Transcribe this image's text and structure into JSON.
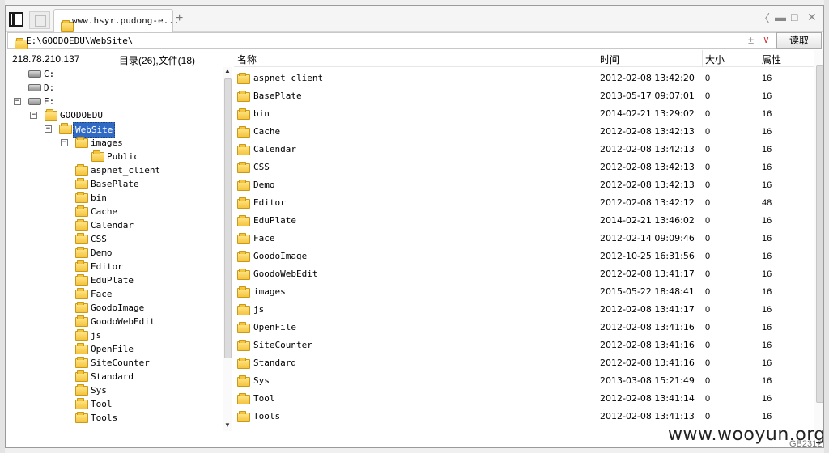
{
  "tabbar": {
    "tab_label": "www.hsyr.pudong-e...",
    "close_glyph": "×",
    "add_glyph": "+",
    "ctrl_back": "〈",
    "ctrl_min": "▬",
    "ctrl_max": "□",
    "ctrl_close": "✕"
  },
  "address": {
    "path": "E:\\GOODOEDU\\WebSite\\",
    "plus_glyph": "±",
    "chevron_glyph": "∨",
    "read_button": "读取"
  },
  "info": {
    "ip": "218.78.210.137",
    "counts": "目录(26),文件(18)"
  },
  "columns": {
    "name": "名称",
    "time": "时间",
    "size": "大小",
    "attr": "属性"
  },
  "tree": {
    "drives": [
      "C:",
      "D:",
      "E:"
    ],
    "goodoedu": "GOODOEDU",
    "website": "WebSite",
    "images": "images",
    "public": "Public",
    "folders": [
      "aspnet_client",
      "BasePlate",
      "bin",
      "Cache",
      "Calendar",
      "CSS",
      "Demo",
      "Editor",
      "EduPlate",
      "Face",
      "GoodoImage",
      "GoodoWebEdit",
      "js",
      "OpenFile",
      "SiteCounter",
      "Standard",
      "Sys",
      "Tool",
      "Tools"
    ],
    "toggle_minus": "−"
  },
  "files": [
    {
      "name": "aspnet_client",
      "time": "2012-02-08 13:42:20",
      "size": "0",
      "attr": "16"
    },
    {
      "name": "BasePlate",
      "time": "2013-05-17 09:07:01",
      "size": "0",
      "attr": "16"
    },
    {
      "name": "bin",
      "time": "2014-02-21 13:29:02",
      "size": "0",
      "attr": "16"
    },
    {
      "name": "Cache",
      "time": "2012-02-08 13:42:13",
      "size": "0",
      "attr": "16"
    },
    {
      "name": "Calendar",
      "time": "2012-02-08 13:42:13",
      "size": "0",
      "attr": "16"
    },
    {
      "name": "CSS",
      "time": "2012-02-08 13:42:13",
      "size": "0",
      "attr": "16"
    },
    {
      "name": "Demo",
      "time": "2012-02-08 13:42:13",
      "size": "0",
      "attr": "16"
    },
    {
      "name": "Editor",
      "time": "2012-02-08 13:42:12",
      "size": "0",
      "attr": "48"
    },
    {
      "name": "EduPlate",
      "time": "2014-02-21 13:46:02",
      "size": "0",
      "attr": "16"
    },
    {
      "name": "Face",
      "time": "2012-02-14 09:09:46",
      "size": "0",
      "attr": "16"
    },
    {
      "name": "GoodoImage",
      "time": "2012-10-25 16:31:56",
      "size": "0",
      "attr": "16"
    },
    {
      "name": "GoodoWebEdit",
      "time": "2012-02-08 13:41:17",
      "size": "0",
      "attr": "16"
    },
    {
      "name": "images",
      "time": "2015-05-22 18:48:41",
      "size": "0",
      "attr": "16"
    },
    {
      "name": "js",
      "time": "2012-02-08 13:41:17",
      "size": "0",
      "attr": "16"
    },
    {
      "name": "OpenFile",
      "time": "2012-02-08 13:41:16",
      "size": "0",
      "attr": "16"
    },
    {
      "name": "SiteCounter",
      "time": "2012-02-08 13:41:16",
      "size": "0",
      "attr": "16"
    },
    {
      "name": "Standard",
      "time": "2012-02-08 13:41:16",
      "size": "0",
      "attr": "16"
    },
    {
      "name": "Sys",
      "time": "2013-03-08 15:21:49",
      "size": "0",
      "attr": "16"
    },
    {
      "name": "Tool",
      "time": "2012-02-08 13:41:14",
      "size": "0",
      "attr": "16"
    },
    {
      "name": "Tools",
      "time": "2012-02-08 13:41:13",
      "size": "0",
      "attr": "16"
    }
  ],
  "watermark": "www.wooyun.org",
  "corner_text": "GB2312",
  "colors": {
    "selection": "#316ac5",
    "folder": "#f5c43d",
    "close_accent": "#d23b3b"
  },
  "icons": {
    "folder": "folder-icon",
    "drive": "drive-icon",
    "sidebar": "sidebar-toggle-icon"
  }
}
